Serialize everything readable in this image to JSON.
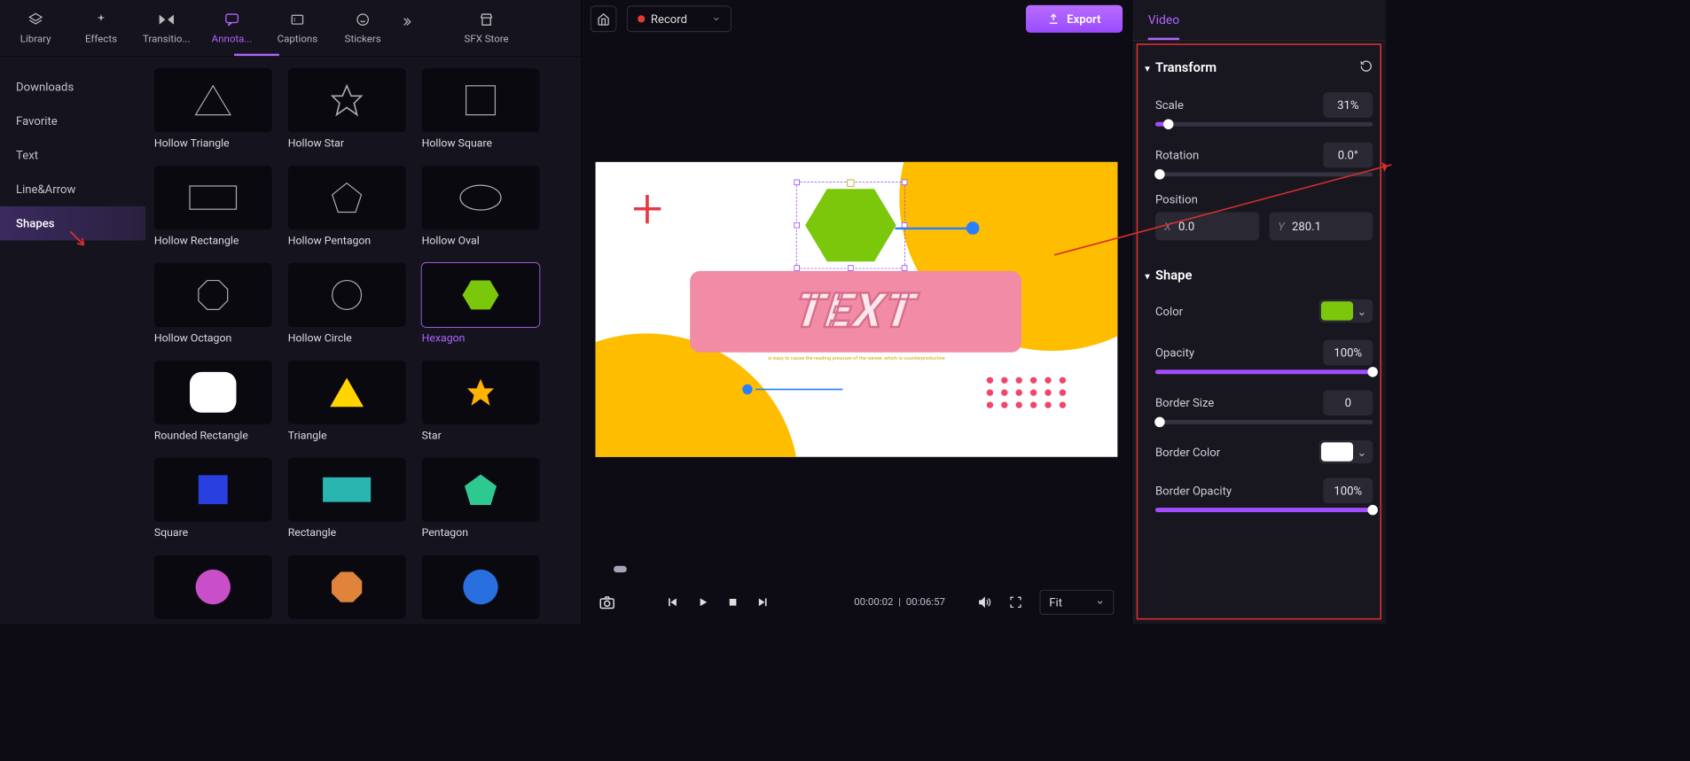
{
  "top_tabs": {
    "library": "Library",
    "effects": "Effects",
    "transitions": "Transitio...",
    "annotations": "Annota...",
    "captions": "Captions",
    "stickers": "Stickers",
    "sfx_store": "SFX Store"
  },
  "sidebar": {
    "downloads": "Downloads",
    "favorite": "Favorite",
    "text": "Text",
    "line_arrow": "Line&Arrow",
    "shapes": "Shapes"
  },
  "shapes": [
    {
      "label": "Hollow Triangle"
    },
    {
      "label": "Hollow Star"
    },
    {
      "label": "Hollow Square"
    },
    {
      "label": "Hollow Rectangle"
    },
    {
      "label": "Hollow Pentagon"
    },
    {
      "label": "Hollow Oval"
    },
    {
      "label": "Hollow Octagon"
    },
    {
      "label": "Hollow Circle"
    },
    {
      "label": "Hexagon",
      "selected": true
    },
    {
      "label": "Rounded Rectangle"
    },
    {
      "label": "Triangle"
    },
    {
      "label": "Star"
    },
    {
      "label": "Square"
    },
    {
      "label": "Rectangle"
    },
    {
      "label": "Pentagon"
    }
  ],
  "center": {
    "record_label": "Record",
    "export_label": "Export",
    "canvas_text": "TEXT",
    "subtitle": "is easy to cause the reading pressure of the viewer, which is counterproductive",
    "time_current": "00:00:02",
    "time_total": "00:06:57",
    "fit_label": "Fit"
  },
  "right": {
    "tab_video": "Video",
    "sections": {
      "transform": "Transform",
      "shape": "Shape"
    },
    "transform": {
      "scale_label": "Scale",
      "scale_value": "31%",
      "rotation_label": "Rotation",
      "rotation_value": "0.0°",
      "position_label": "Position",
      "pos_x": "0.0",
      "pos_y": "280.1"
    },
    "shape": {
      "color_label": "Color",
      "color_value": "#7ac70c",
      "opacity_label": "Opacity",
      "opacity_value": "100%",
      "border_size_label": "Border Size",
      "border_size_value": "0",
      "border_color_label": "Border Color",
      "border_color_value": "#ffffff",
      "border_opacity_label": "Border Opacity",
      "border_opacity_value": "100%"
    }
  }
}
